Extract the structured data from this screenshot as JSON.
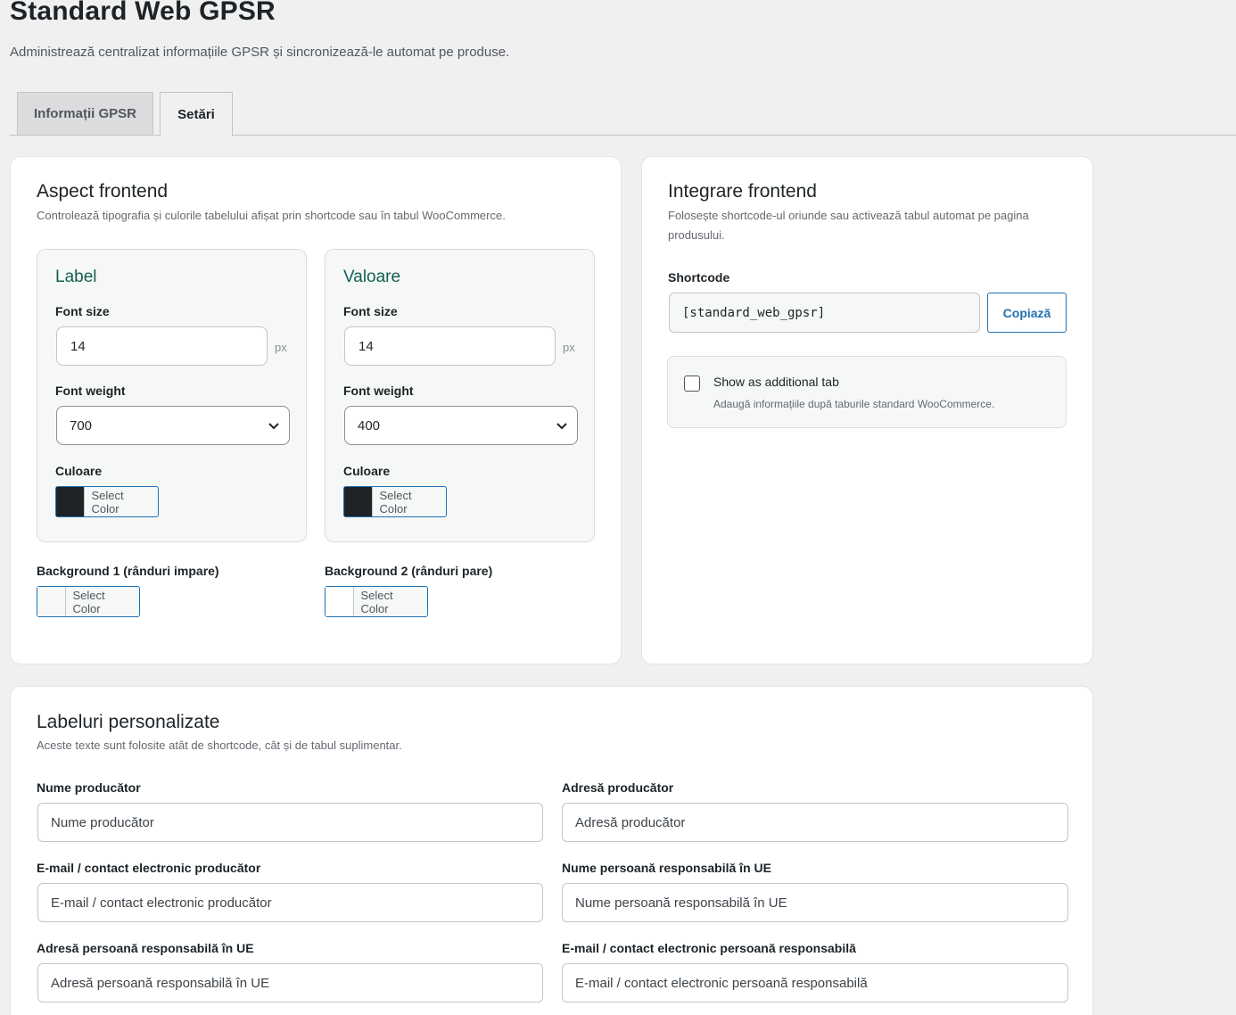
{
  "page": {
    "title": "Standard Web GPSR",
    "description": "Administrează centralizat informațiile GPSR și sincronizează-le automat pe produse."
  },
  "tabs": [
    {
      "label": "Informații GPSR",
      "active": false
    },
    {
      "label": "Setări",
      "active": true
    }
  ],
  "aspect": {
    "title": "Aspect frontend",
    "subtitle": "Controlează tipografia și culorile tabelului afișat prin shortcode sau în tabul WooCommerce.",
    "label_panel": {
      "title": "Label",
      "font_size_label": "Font size",
      "font_size_value": "14",
      "unit": "px",
      "font_weight_label": "Font weight",
      "font_weight_value": "700",
      "color_label": "Culoare",
      "color_button": "Select Color",
      "color": "#1d2327"
    },
    "value_panel": {
      "title": "Valoare",
      "font_size_label": "Font size",
      "font_size_value": "14",
      "unit": "px",
      "font_weight_label": "Font weight",
      "font_weight_value": "400",
      "color_label": "Culoare",
      "color_button": "Select Color",
      "color": "#1d2327"
    },
    "bg1": {
      "label": "Background 1 (rânduri impare)",
      "button": "Select Color",
      "color": "#f6f7f7"
    },
    "bg2": {
      "label": "Background 2 (rânduri pare)",
      "button": "Select Color",
      "color": "#ffffff"
    }
  },
  "integration": {
    "title": "Integrare frontend",
    "subtitle_line1": "Folosește shortcode-ul oriunde sau activează tabul automat pe pagina",
    "subtitle_line2": "produsului.",
    "shortcode_label": "Shortcode",
    "shortcode_value": "[standard_web_gpsr]",
    "copy_button": "Copiază",
    "toggle_label": "Show as additional tab",
    "toggle_desc": "Adaugă informațiile după taburile standard WooCommerce.",
    "toggle_checked": false
  },
  "labels": {
    "title": "Labeluri personalizate",
    "subtitle": "Aceste texte sunt folosite atât de shortcode, cât și de tabul suplimentar.",
    "fields": [
      {
        "label": "Nume producător",
        "value": "Nume producător"
      },
      {
        "label": "Adresă producător",
        "value": "Adresă producător"
      },
      {
        "label": "E-mail / contact electronic producător",
        "value": "E-mail / contact electronic producător"
      },
      {
        "label": "Nume persoană responsabilă în UE",
        "value": "Nume persoană responsabilă în UE"
      },
      {
        "label": "Adresă persoană responsabilă în UE",
        "value": "Adresă persoană responsabilă în UE"
      },
      {
        "label": "E-mail / contact electronic persoană responsabilă",
        "value": "E-mail / contact electronic persoană responsabilă"
      }
    ]
  }
}
